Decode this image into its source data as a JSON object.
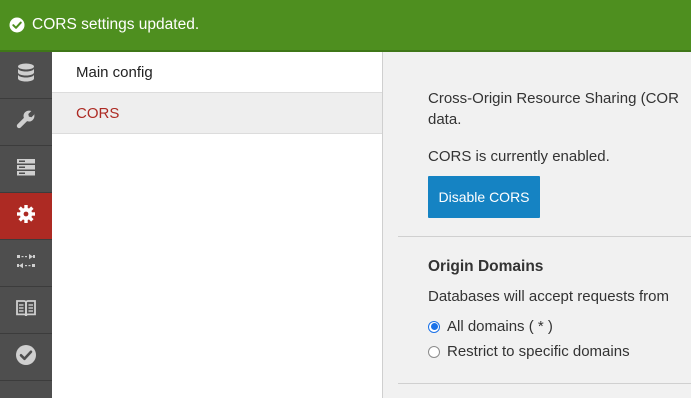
{
  "banner": {
    "icon": "check-circle-icon",
    "message": "CORS settings updated.",
    "color": "#4e8f1f"
  },
  "rail": {
    "items": [
      {
        "icon": "database-icon",
        "active": false
      },
      {
        "icon": "wrench-icon",
        "active": false
      },
      {
        "icon": "server-icon",
        "active": false
      },
      {
        "icon": "gear-icon",
        "active": true
      },
      {
        "icon": "replication-icon",
        "active": false
      },
      {
        "icon": "book-icon",
        "active": false
      },
      {
        "icon": "checkmark-icon",
        "active": false
      }
    ],
    "active_color": "#ad2a23"
  },
  "subnav": {
    "items": [
      {
        "label": "Main config",
        "active": false
      },
      {
        "label": "CORS",
        "active": true
      }
    ]
  },
  "main": {
    "description": "Cross-Origin Resource Sharing (CORS) lets you connect to remote servers directly from the browser, so you can host browser-based apps on static pages and talk directly with CouchDB to load your data.",
    "description_visible_line1": "Cross-Origin Resource Sharing (COR",
    "description_visible_line2": "data.",
    "status": "CORS is currently enabled.",
    "disable_button": "Disable CORS",
    "button_color": "#1583c3",
    "origin_title": "Origin Domains",
    "origin_description": "Databases will accept requests from",
    "options": [
      {
        "label": "All domains ( * )",
        "checked": true
      },
      {
        "label": "Restrict to specific domains",
        "checked": false
      }
    ]
  }
}
